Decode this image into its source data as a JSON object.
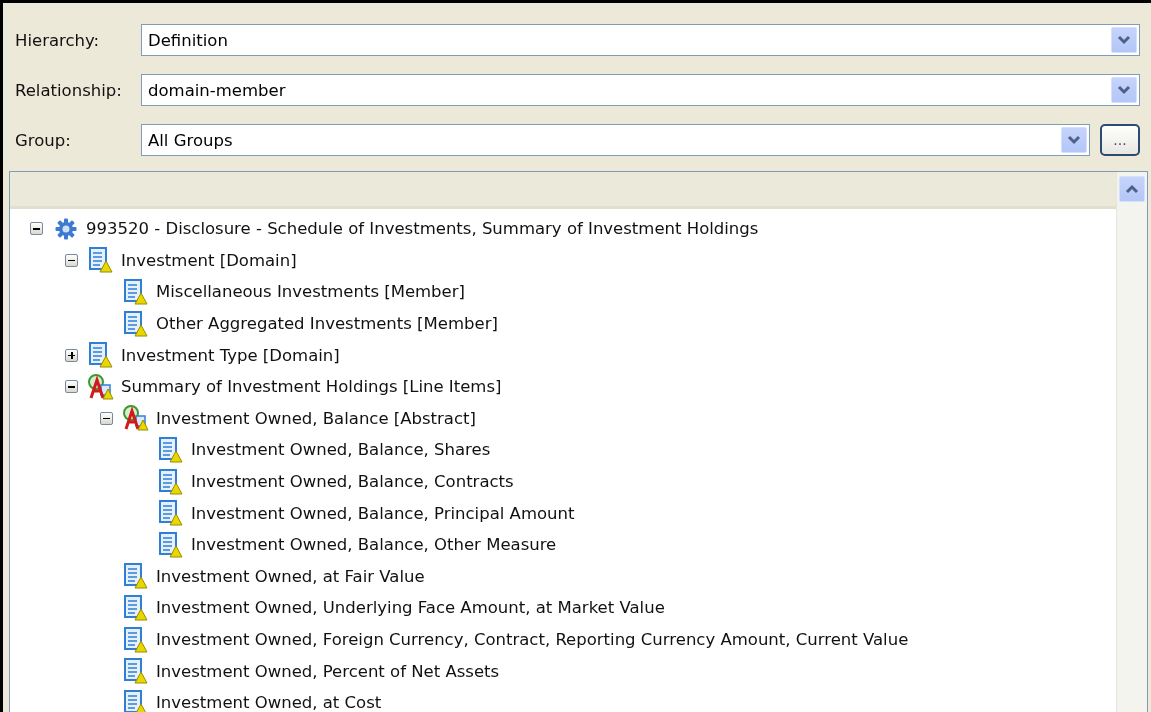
{
  "fields": [
    {
      "label": "Hierarchy:",
      "value": "Definition"
    },
    {
      "label": "Relationship:",
      "value": "domain-member"
    },
    {
      "label": "Group:",
      "value": "All Groups",
      "browse_label": "..."
    }
  ],
  "tree": [
    {
      "label": "993520 - Disclosure - Schedule of Investments, Summary of Investment Holdings",
      "kind": "group",
      "expanded": true,
      "children": [
        {
          "label": "Investment [Domain]",
          "kind": "concept",
          "expanded": true,
          "children": [
            {
              "label": "Miscellaneous Investments [Member]",
              "kind": "concept"
            },
            {
              "label": "Other Aggregated Investments [Member]",
              "kind": "concept"
            }
          ]
        },
        {
          "label": "Investment Type [Domain]",
          "kind": "concept",
          "expanded": false
        },
        {
          "label": "Summary of Investment Holdings [Line Items]",
          "kind": "abstract",
          "expanded": true,
          "children": [
            {
              "label": "Investment Owned, Balance [Abstract]",
              "kind": "abstract",
              "expanded": true,
              "children": [
                {
                  "label": "Investment Owned, Balance, Shares",
                  "kind": "concept"
                },
                {
                  "label": "Investment Owned, Balance, Contracts",
                  "kind": "concept"
                },
                {
                  "label": "Investment Owned, Balance, Principal Amount",
                  "kind": "concept"
                },
                {
                  "label": "Investment Owned, Balance, Other Measure",
                  "kind": "concept"
                }
              ]
            },
            {
              "label": "Investment Owned, at Fair Value",
              "kind": "concept"
            },
            {
              "label": "Investment Owned, Underlying Face Amount, at Market Value",
              "kind": "concept"
            },
            {
              "label": "Investment Owned, Foreign Currency, Contract, Reporting Currency Amount, Current Value",
              "kind": "concept"
            },
            {
              "label": "Investment Owned, Percent of Net Assets",
              "kind": "concept"
            },
            {
              "label": "Investment Owned, at Cost",
              "kind": "concept"
            }
          ]
        }
      ]
    }
  ]
}
